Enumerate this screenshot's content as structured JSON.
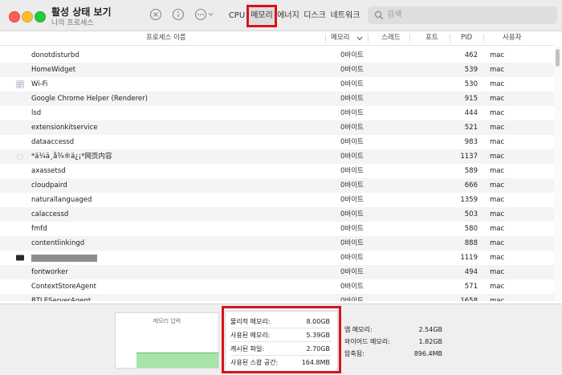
{
  "window": {
    "title": "활성 상태 보기",
    "subtitle": "나의 프로세스"
  },
  "tabs": [
    {
      "label": "CPU",
      "selected": false
    },
    {
      "label": "메모리",
      "selected": true
    },
    {
      "label": "에너지",
      "selected": false
    },
    {
      "label": "디스크",
      "selected": false
    },
    {
      "label": "네트워크",
      "selected": false
    }
  ],
  "search": {
    "placeholder": "검색"
  },
  "columns": {
    "process_name": "프로세스 이름",
    "memory": "메모리",
    "threads": "스레드",
    "ports": "포트",
    "pid": "PID",
    "user": "사용자"
  },
  "processes": [
    {
      "name": "donotdisturbd",
      "memory": "0바이트",
      "pid": "462",
      "user": "mac"
    },
    {
      "name": "HomeWidget",
      "memory": "0바이트",
      "pid": "539",
      "user": "mac"
    },
    {
      "name": "Wi-Fi",
      "memory": "0바이트",
      "pid": "530",
      "user": "mac"
    },
    {
      "name": "Google Chrome Helper (Renderer)",
      "memory": "0바이트",
      "pid": "915",
      "user": "mac"
    },
    {
      "name": "lsd",
      "memory": "0바이트",
      "pid": "444",
      "user": "mac"
    },
    {
      "name": "extensionkitservice",
      "memory": "0바이트",
      "pid": "521",
      "user": "mac"
    },
    {
      "name": "dataaccessd",
      "memory": "0바이트",
      "pid": "983",
      "user": "mac"
    },
    {
      "name": "*ä¼ä¸å¾®ä¿¡*网页内容",
      "memory": "0바이트",
      "pid": "1137",
      "user": "mac"
    },
    {
      "name": "axassetsd",
      "memory": "0바이트",
      "pid": "589",
      "user": "mac"
    },
    {
      "name": "cloudpaird",
      "memory": "0바이트",
      "pid": "666",
      "user": "mac"
    },
    {
      "name": "naturallanguaged",
      "memory": "0바이트",
      "pid": "1359",
      "user": "mac"
    },
    {
      "name": "calaccessd",
      "memory": "0바이트",
      "pid": "503",
      "user": "mac"
    },
    {
      "name": "fmfd",
      "memory": "0바이트",
      "pid": "580",
      "user": "mac"
    },
    {
      "name": "contentlinkingd",
      "memory": "0바이트",
      "pid": "888",
      "user": "mac"
    },
    {
      "name": "",
      "memory": "0바이트",
      "pid": "1119",
      "user": "mac"
    },
    {
      "name": "fontworker",
      "memory": "0바이트",
      "pid": "494",
      "user": "mac"
    },
    {
      "name": "ContextStoreAgent",
      "memory": "0바이트",
      "pid": "571",
      "user": "mac"
    },
    {
      "name": "BTLEServerAgent",
      "memory": "0바이트",
      "pid": "1658",
      "user": "mac"
    }
  ],
  "memory_pressure": {
    "label": "메모리 압력"
  },
  "memory_stats": [
    {
      "label": "물리적 메모리:",
      "value": "8.00GB"
    },
    {
      "label": "사용된 메모리:",
      "value": "5.39GB"
    },
    {
      "label": "캐시된 파일:",
      "value": "2.70GB"
    },
    {
      "label": "사용된 스왑 공간:",
      "value": "164.8MB"
    }
  ],
  "memory_stats_right": [
    {
      "label": "앱 메모리:",
      "value": "2.54GB"
    },
    {
      "label": "와이어드 메모리:",
      "value": "1.82GB"
    },
    {
      "label": "압축됨:",
      "value": "896.4MB"
    }
  ],
  "colors": {
    "highlight": "#d8131b",
    "pressure_fill": "#a7e4a8"
  }
}
